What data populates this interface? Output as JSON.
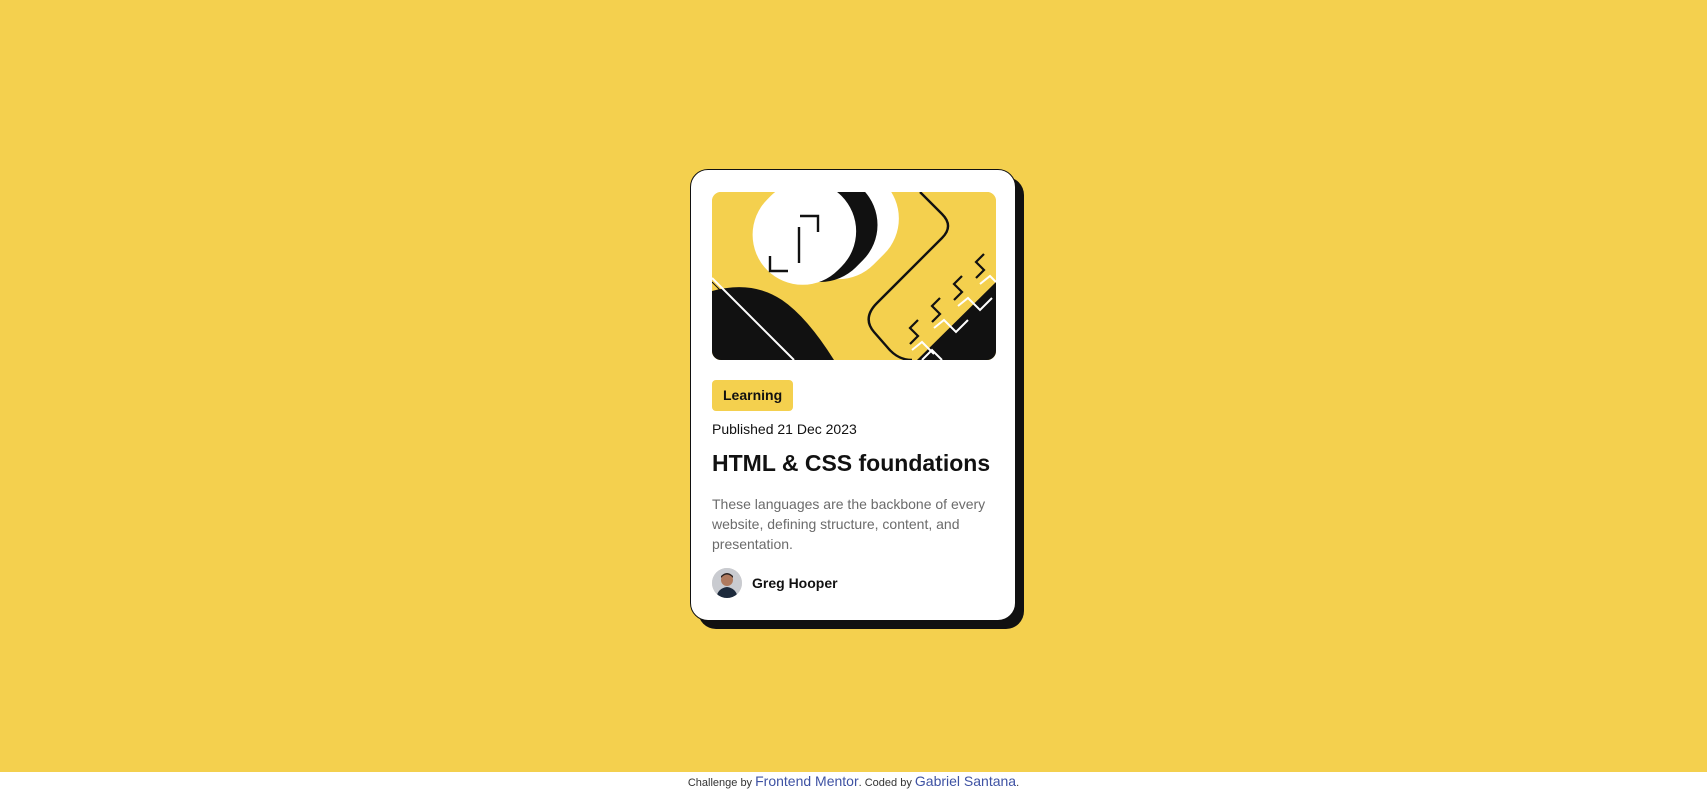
{
  "card": {
    "tag": "Learning",
    "published": "Published 21 Dec 2023",
    "title": "HTML & CSS foundations",
    "description": "These languages are the backbone of every website, defining structure, content, and presentation.",
    "author": "Greg Hooper",
    "hero_icon": "illustration-article",
    "avatar_icon": "author-avatar"
  },
  "attribution": {
    "challenge_prefix": "Challenge by",
    "challenge_link": "Frontend Mentor",
    "coded_prefix": ". Coded by",
    "coded_link": "Gabriel Santana",
    "suffix": "."
  },
  "colors": {
    "background": "#f4d04e",
    "card": "#ffffff",
    "ink": "#111111",
    "muted": "#6b6b6b",
    "link": "#3e52a3"
  }
}
